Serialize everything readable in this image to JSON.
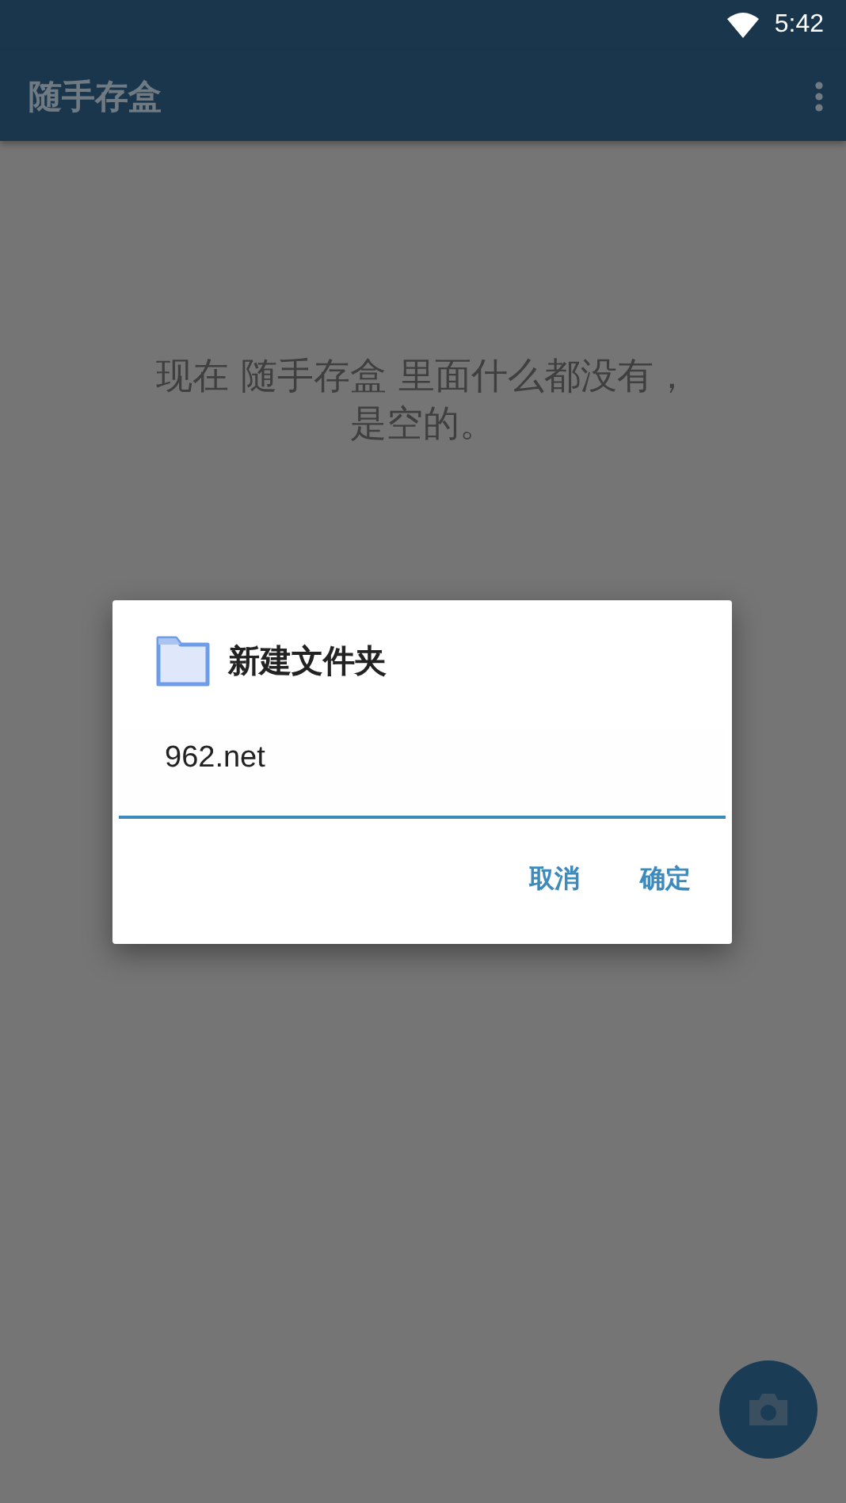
{
  "status_bar": {
    "time": "5:42"
  },
  "app_bar": {
    "title": "随手存盒"
  },
  "empty_message": {
    "lines": [
      "现在 随手存盒 里面什么都没有，",
      "是空的。"
    ]
  },
  "dialog": {
    "title": "新建文件夹",
    "input_value": "962.net",
    "buttons": [
      "取消",
      "确定"
    ]
  }
}
